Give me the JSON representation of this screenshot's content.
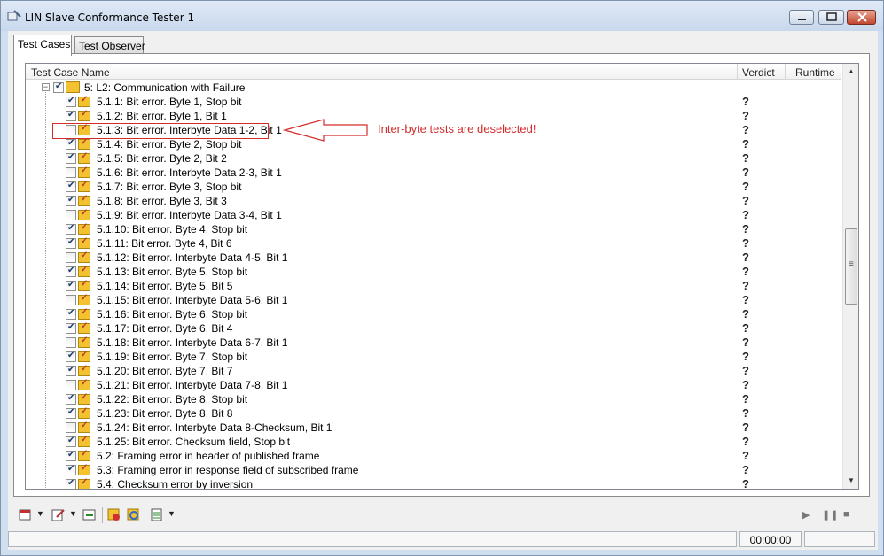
{
  "window": {
    "title": "LIN Slave Conformance Tester 1",
    "title_icon": "tester-icon",
    "minimize_icon": "minimize-icon",
    "maximize_icon": "maximize-icon",
    "close_icon": "close-icon"
  },
  "tabs": [
    {
      "label": "Test Cases",
      "active": true
    },
    {
      "label": "Test Observer",
      "active": false
    }
  ],
  "grid": {
    "columns": [
      "Test Case Name",
      "Verdict",
      "Runtime"
    ],
    "group": {
      "label": "5: L2: Communication with Failure",
      "expanded": true,
      "checked": true
    },
    "rows": [
      {
        "label": "5.1.1: Bit error. Byte 1, Stop bit",
        "checked": true,
        "verdict": "?"
      },
      {
        "label": "5.1.2: Bit error. Byte 1, Bit 1",
        "checked": true,
        "verdict": "?"
      },
      {
        "label": "5.1.3: Bit error. Interbyte Data 1-2, Bit 1",
        "checked": false,
        "verdict": "?"
      },
      {
        "label": "5.1.4: Bit error. Byte 2, Stop bit",
        "checked": true,
        "verdict": "?"
      },
      {
        "label": "5.1.5: Bit error. Byte 2, Bit 2",
        "checked": true,
        "verdict": "?"
      },
      {
        "label": "5.1.6: Bit error. Interbyte Data 2-3, Bit 1",
        "checked": false,
        "verdict": "?"
      },
      {
        "label": "5.1.7: Bit error. Byte 3, Stop bit",
        "checked": true,
        "verdict": "?"
      },
      {
        "label": "5.1.8: Bit error. Byte 3, Bit 3",
        "checked": true,
        "verdict": "?"
      },
      {
        "label": "5.1.9: Bit error. Interbyte Data 3-4, Bit 1",
        "checked": false,
        "verdict": "?"
      },
      {
        "label": "5.1.10: Bit error. Byte 4, Stop bit",
        "checked": true,
        "verdict": "?"
      },
      {
        "label": "5.1.11: Bit error. Byte 4, Bit 6",
        "checked": true,
        "verdict": "?"
      },
      {
        "label": "5.1.12: Bit error. Interbyte Data 4-5, Bit 1",
        "checked": false,
        "verdict": "?"
      },
      {
        "label": "5.1.13: Bit error. Byte 5, Stop bit",
        "checked": true,
        "verdict": "?"
      },
      {
        "label": "5.1.14: Bit error. Byte 5, Bit 5",
        "checked": true,
        "verdict": "?"
      },
      {
        "label": "5.1.15: Bit error. Interbyte Data 5-6, Bit 1",
        "checked": false,
        "verdict": "?"
      },
      {
        "label": "5.1.16: Bit error. Byte 6, Stop bit",
        "checked": true,
        "verdict": "?"
      },
      {
        "label": "5.1.17: Bit error. Byte 6, Bit 4",
        "checked": true,
        "verdict": "?"
      },
      {
        "label": "5.1.18: Bit error. Interbyte Data 6-7, Bit 1",
        "checked": false,
        "verdict": "?"
      },
      {
        "label": "5.1.19: Bit error. Byte 7, Stop bit",
        "checked": true,
        "verdict": "?"
      },
      {
        "label": "5.1.20: Bit error. Byte 7, Bit 7",
        "checked": true,
        "verdict": "?"
      },
      {
        "label": "5.1.21: Bit error. Interbyte Data 7-8, Bit 1",
        "checked": false,
        "verdict": "?"
      },
      {
        "label": "5.1.22: Bit error. Byte 8, Stop bit",
        "checked": true,
        "verdict": "?"
      },
      {
        "label": "5.1.23: Bit error. Byte 8, Bit 8",
        "checked": true,
        "verdict": "?"
      },
      {
        "label": "5.1.24: Bit error. Interbyte Data 8-Checksum, Bit 1",
        "checked": false,
        "verdict": "?"
      },
      {
        "label": "5.1.25: Bit error. Checksum field, Stop bit",
        "checked": true,
        "verdict": "?"
      },
      {
        "label": "5.2: Framing error in header of published frame",
        "checked": true,
        "verdict": "?"
      },
      {
        "label": "5.3: Framing error in response field of subscribed frame",
        "checked": true,
        "verdict": "?"
      },
      {
        "label": "5.4: Checksum error by inversion",
        "checked": true,
        "verdict": "?"
      }
    ]
  },
  "annotation": {
    "text": "Inter-byte tests are deselected!",
    "color": "#d42b2b"
  },
  "toolbar": {
    "icons": [
      "new-config-icon",
      "edit-icon",
      "export-icon",
      "stop-cancel-icon",
      "refresh-icon",
      "report-icon"
    ],
    "playback": [
      "play-icon",
      "pause-icon",
      "stop-icon"
    ]
  },
  "status": {
    "elapsed": "00:00:00"
  }
}
